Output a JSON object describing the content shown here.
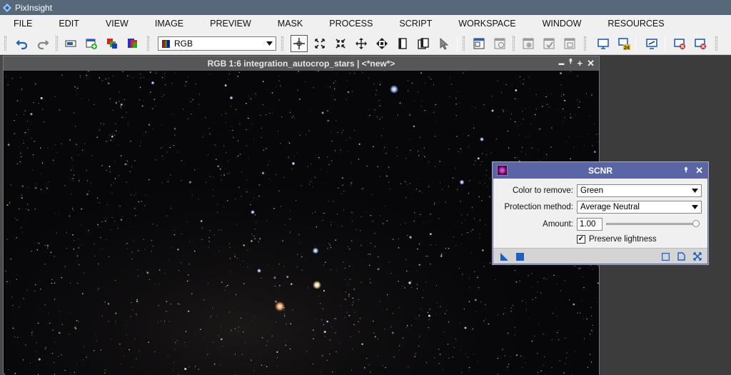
{
  "app": {
    "title": "PixInsight"
  },
  "menu": [
    "FILE",
    "EDIT",
    "VIEW",
    "IMAGE",
    "PREVIEW",
    "MASK",
    "PROCESS",
    "SCRIPT",
    "WORKSPACE",
    "WINDOW",
    "RESOURCES"
  ],
  "toolbar": {
    "channel_combo_value": "RGB",
    "icons": [
      "undo-icon",
      "redo-icon",
      "identifier-icon",
      "new-image-icon",
      "extract-channels-icon",
      "rgb-working-space-icon",
      "zoom-fit-icon",
      "zoom-in-icon",
      "zoom-out-icon",
      "pan-icon",
      "readout-icon",
      "window-icon",
      "window-stack-icon",
      "cursor-icon",
      "preview-icon",
      "preview-delete-icon",
      "mask-icon",
      "mask-enable-icon",
      "mask-show-icon",
      "screen-icon",
      "screen-24-icon",
      "stf-icon",
      "stf-reset-icon",
      "stf-disable-icon"
    ]
  },
  "image_window": {
    "title": "RGB 1:6 integration_autocrop_stars | <*new*>",
    "controls": {
      "shade": "▬",
      "collapse": "⯭",
      "maximize": "+",
      "close": "✕"
    }
  },
  "scnr": {
    "title": "SCNR",
    "color_label": "Color to remove:",
    "color_value": "Green",
    "protection_label": "Protection method:",
    "protection_value": "Average Neutral",
    "amount_label": "Amount:",
    "amount_value": "1.00",
    "amount_fraction": 1.0,
    "preserve_label": "Preserve lightness",
    "preserve_checked": true,
    "controls": {
      "collapse": "⯭",
      "close": "✕"
    }
  },
  "colors": {
    "titlebar": "#56687a",
    "dialog_header": "#5a65a6",
    "accent": "#1e5fbf"
  }
}
